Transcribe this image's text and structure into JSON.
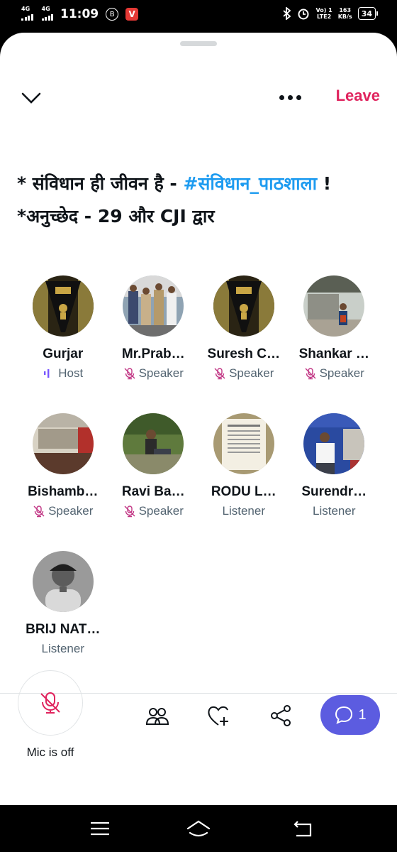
{
  "status_bar": {
    "network_1": "4G",
    "network_2": "4G",
    "time": "11:09",
    "badge_b": "B",
    "badge_v": "V",
    "volte_top": "Vo) 1",
    "volte_bottom": "LTE2",
    "speed_top": "163",
    "speed_bottom": "KB/s",
    "battery": "34"
  },
  "header": {
    "leave_label": "Leave"
  },
  "space": {
    "title_prefix": "*  संविधान ही जीवन है - ",
    "hashtag": "#संविधान_पाठशाला",
    "title_suffix": " ! *अनुच्छेद - 29 और CJI द्वार"
  },
  "participants": [
    {
      "name": "Gurjar",
      "role": "Host",
      "role_icon": "host-bars-icon",
      "avatar": "constitution-book"
    },
    {
      "name": "Mr.Prab…",
      "role": "Speaker",
      "role_icon": "mic-off-icon",
      "avatar": "group-photo"
    },
    {
      "name": "Suresh C…",
      "role": "Speaker",
      "role_icon": "mic-off-icon",
      "avatar": "constitution-book"
    },
    {
      "name": "Shankar …",
      "role": "Speaker",
      "role_icon": "mic-off-icon",
      "avatar": "office-photo"
    },
    {
      "name": "Bishamb…",
      "role": "Speaker",
      "role_icon": "mic-off-icon",
      "avatar": "constitution-banner"
    },
    {
      "name": "Ravi Ba…",
      "role": "Speaker",
      "role_icon": "mic-off-icon",
      "avatar": "outdoor-photo"
    },
    {
      "name": "RODU L…",
      "role": "Listener",
      "role_icon": "",
      "avatar": "certificate"
    },
    {
      "name": "Surendr…",
      "role": "Listener",
      "role_icon": "",
      "avatar": "preamble-photo"
    },
    {
      "name": "BRIJ NAT…",
      "role": "Listener",
      "role_icon": "",
      "avatar": "bw-portrait"
    }
  ],
  "controls": {
    "mic_label": "Mic is off",
    "chat_count": "1"
  },
  "colors": {
    "leave": "#e0245e",
    "hashtag": "#1d9bf0",
    "host_icon": "#7856ff",
    "speaker_icon": "#c13584",
    "chat_button": "#5c5ce0",
    "mic_off": "#e0245e"
  }
}
